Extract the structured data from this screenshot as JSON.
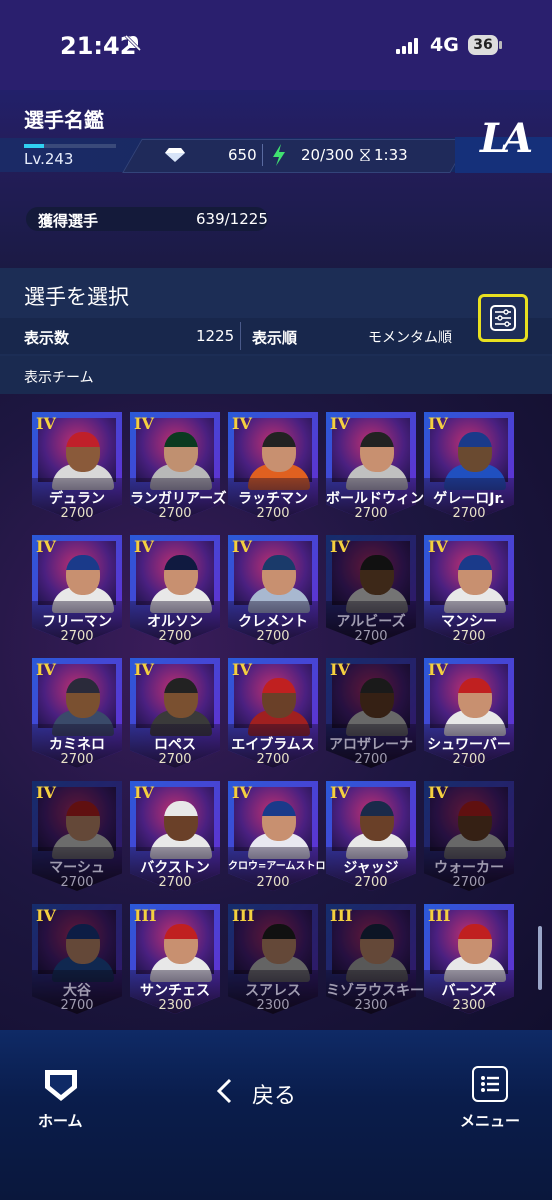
{
  "status": {
    "time": "21:42",
    "network": "4G",
    "battery": "36"
  },
  "header": {
    "title": "選手名鑑",
    "level_label": "Lv.243",
    "level_progress": 0.22,
    "gems": "650",
    "stamina": "20/300",
    "stamina_timer": "1:33",
    "team_logo": "LA",
    "acquired_label": "獲得選手",
    "acquired_value": "639/1225"
  },
  "selection": {
    "title": "選手を選択",
    "count_label": "表示数",
    "count_value": "1225",
    "sort_label": "表示順",
    "sort_value": "モメンタム順",
    "team_label": "表示チーム"
  },
  "cards": [
    {
      "grade": "IV",
      "name": "デュラン",
      "rating": "2700",
      "cap": "#c0202a",
      "skin": "#8a5a3a",
      "body": "#d8d8d8",
      "dim": false
    },
    {
      "grade": "IV",
      "name": "ランガリアーズ",
      "rating": "2700",
      "cap": "#0b3a20",
      "skin": "#c09070",
      "body": "#b8b8b8",
      "dim": false
    },
    {
      "grade": "IV",
      "name": "ラッチマン",
      "rating": "2700",
      "cap": "#222222",
      "skin": "#c89070",
      "body": "#e06020",
      "dim": false
    },
    {
      "grade": "IV",
      "name": "ボールドウィン",
      "rating": "2700",
      "cap": "#222222",
      "skin": "#c89070",
      "body": "#c0c0c0",
      "dim": false
    },
    {
      "grade": "IV",
      "name": "ゲレーロJr.",
      "rating": "2700",
      "cap": "#1a3a8a",
      "skin": "#6a4a30",
      "body": "#2050c0",
      "dim": false
    },
    {
      "grade": "IV",
      "name": "フリーマン",
      "rating": "2700",
      "cap": "#1a3a8a",
      "skin": "#c89070",
      "body": "#e8e8e8",
      "dim": false
    },
    {
      "grade": "IV",
      "name": "オルソン",
      "rating": "2700",
      "cap": "#101a40",
      "skin": "#c89070",
      "body": "#e8e8e8",
      "dim": false
    },
    {
      "grade": "IV",
      "name": "クレメント",
      "rating": "2700",
      "cap": "#1a3a6a",
      "skin": "#c89070",
      "body": "#a8b8d0",
      "dim": false
    },
    {
      "grade": "IV",
      "name": "アルビーズ",
      "rating": "2700",
      "cap": "#222222",
      "skin": "#7a5030",
      "body": "#e8e8e8",
      "dim": true
    },
    {
      "grade": "IV",
      "name": "マンシー",
      "rating": "2700",
      "cap": "#1a3a8a",
      "skin": "#c89070",
      "body": "#e8e8e8",
      "dim": false
    },
    {
      "grade": "IV",
      "name": "カミネロ",
      "rating": "2700",
      "cap": "#2a2a3a",
      "skin": "#7a5030",
      "body": "#3a4a6a",
      "dim": false
    },
    {
      "grade": "IV",
      "name": "ロペス",
      "rating": "2700",
      "cap": "#222222",
      "skin": "#7a5030",
      "body": "#3a3a3a",
      "dim": false
    },
    {
      "grade": "IV",
      "name": "エイブラムス",
      "rating": "2700",
      "cap": "#c02020",
      "skin": "#6a4028",
      "body": "#a02020",
      "dim": false
    },
    {
      "grade": "IV",
      "name": "アロザレーナ",
      "rating": "2700",
      "cap": "#333333",
      "skin": "#6a4028",
      "body": "#d0d0d0",
      "dim": true
    },
    {
      "grade": "IV",
      "name": "シュワーバー",
      "rating": "2700",
      "cap": "#c02020",
      "skin": "#c89070",
      "body": "#e8e8e8",
      "dim": false
    },
    {
      "grade": "IV",
      "name": "マーシュ",
      "rating": "2700",
      "cap": "#c02020",
      "skin": "#c89070",
      "body": "#d8d8d8",
      "dim": true
    },
    {
      "grade": "IV",
      "name": "バクストン",
      "rating": "2700",
      "cap": "#e8e8e8",
      "skin": "#6a4028",
      "body": "#e8e8e8",
      "dim": false
    },
    {
      "grade": "IV",
      "name": "クロウ=アームストロング",
      "rating": "2700",
      "cap": "#1a3a8a",
      "skin": "#c89070",
      "body": "#e8e8f0",
      "dim": false,
      "small": true
    },
    {
      "grade": "IV",
      "name": "ジャッジ",
      "rating": "2700",
      "cap": "#1a2a4a",
      "skin": "#6a4028",
      "body": "#e8e8e8",
      "dim": false
    },
    {
      "grade": "IV",
      "name": "ウォーカー",
      "rating": "2700",
      "cap": "#c02020",
      "skin": "#6a4028",
      "body": "#d0d0d0",
      "dim": true
    },
    {
      "grade": "IV",
      "name": "大谷",
      "rating": "2700",
      "cap": "#1a3a8a",
      "skin": "#c89070",
      "body": "#2050a0",
      "dim": true
    },
    {
      "grade": "III",
      "name": "サンチェス",
      "rating": "2300",
      "cap": "#c02020",
      "skin": "#c89070",
      "body": "#e8e8e8",
      "dim": false
    },
    {
      "grade": "III",
      "name": "スアレス",
      "rating": "2300",
      "cap": "#222222",
      "skin": "#c89070",
      "body": "#c8c8c8",
      "dim": true
    },
    {
      "grade": "III",
      "name": "ミゾラウスキー",
      "rating": "2300",
      "cap": "#1a2a4a",
      "skin": "#c89070",
      "body": "#b0b0b0",
      "dim": true
    },
    {
      "grade": "III",
      "name": "バーンズ",
      "rating": "2300",
      "cap": "#c02020",
      "skin": "#c89070",
      "body": "#e8e8e8",
      "dim": false
    }
  ],
  "nav": {
    "home_label": "ホーム",
    "back_label": "戻る",
    "menu_label": "メニュー"
  },
  "colors": {
    "accent": "#e8e020",
    "frame_blue": "#2a5ad8",
    "frame_purple": "#6a2ad0"
  }
}
